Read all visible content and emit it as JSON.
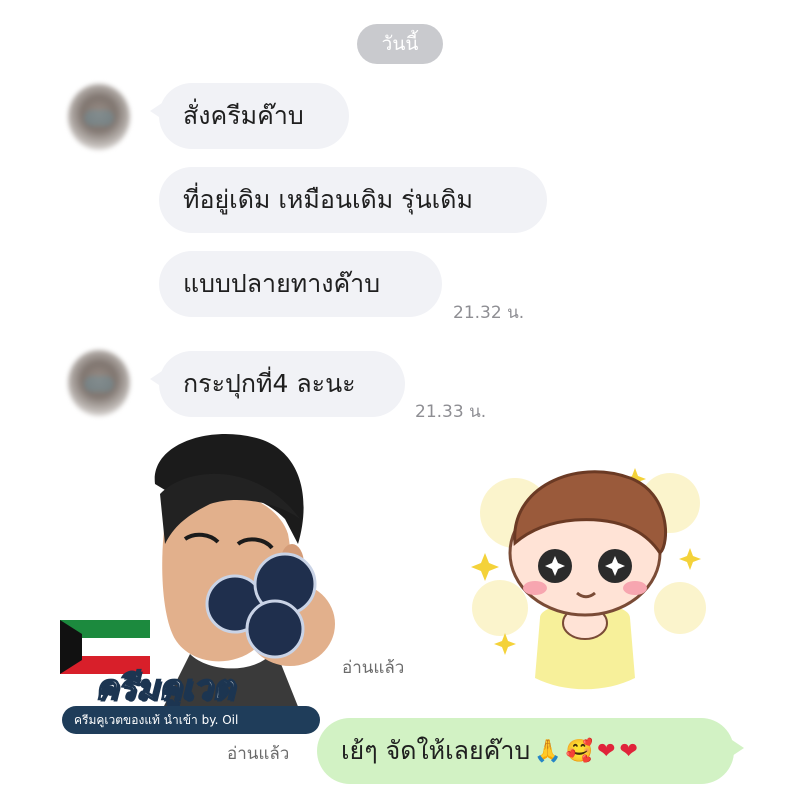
{
  "chat": {
    "date_label": "วันนี้",
    "incoming": [
      {
        "text": "สั่งครีมค๊าบ"
      },
      {
        "text": "ที่อยู่เดิม เหมือนเดิม รุ่นเดิม"
      },
      {
        "text": "แบบปลายทางค๊าบ",
        "time": "21.32 น."
      },
      {
        "text": "กระปุกที่4 ละนะ",
        "time": "21.33 น."
      }
    ],
    "stickers": {
      "left_title": "ครีมคูเวต",
      "left_banner": "ครีมคูเวตของแท้ นำเข้า by. Oil",
      "left_read": "อ่านแล้ว"
    },
    "outgoing": {
      "read": "อ่านแล้ว",
      "text": "เย้ๆ จัดให้เลยค๊าบ",
      "emojis": [
        "🙏",
        "🥰",
        "❤",
        "❤"
      ]
    }
  },
  "colors": {
    "incoming_bubble": "#f1f2f6",
    "outgoing_bubble": "#d2f2c4",
    "date_pill": "#c9cace",
    "timestamp": "#8e8e93"
  },
  "icons": {
    "pray": "folded-hands-icon",
    "smile": "smiling-face-with-hearts-icon",
    "heart": "red-heart-icon"
  }
}
